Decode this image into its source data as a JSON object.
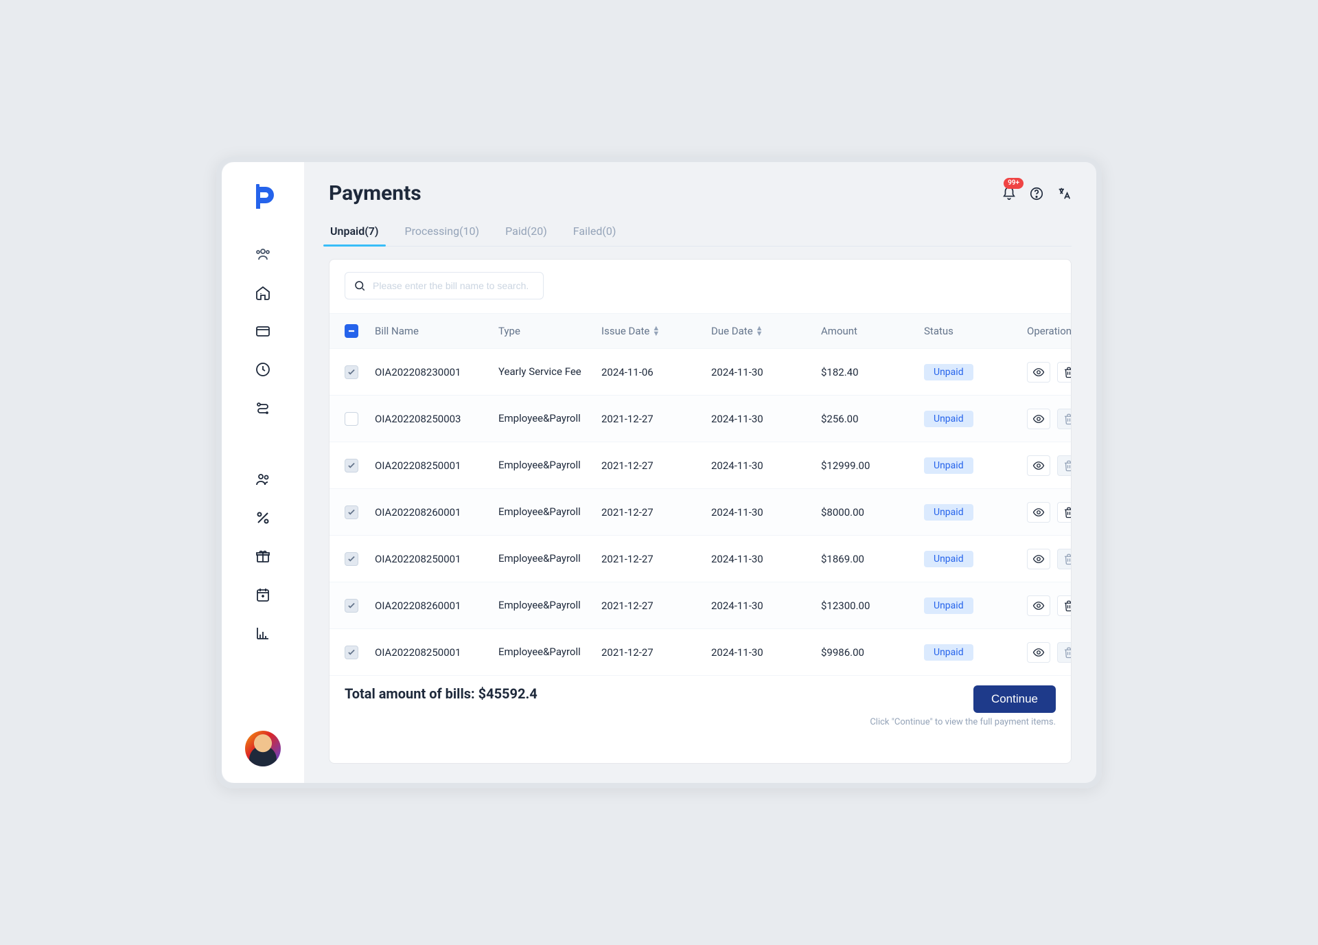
{
  "header": {
    "title": "Payments",
    "notification_badge": "99+"
  },
  "tabs": [
    {
      "label": "Unpaid(7)",
      "active": true
    },
    {
      "label": "Processing(10)",
      "active": false
    },
    {
      "label": "Paid(20)",
      "active": false
    },
    {
      "label": "Failed(0)",
      "active": false
    }
  ],
  "search": {
    "placeholder": "Please enter the bill name to search."
  },
  "columns": {
    "bill_name": "Bill Name",
    "type": "Type",
    "issue_date": "Issue Date",
    "due_date": "Due Date",
    "amount": "Amount",
    "status": "Status",
    "operation": "Operation"
  },
  "rows": [
    {
      "checked": true,
      "bill": "OIA202208230001",
      "type": "Yearly Service Fee",
      "issue": "2024-11-06",
      "due": "2024-11-30",
      "amount": "$182.40",
      "status": "Unpaid",
      "delete_disabled": false
    },
    {
      "checked": false,
      "bill": "OIA202208250003",
      "type": "Employee&Payroll",
      "issue": "2021-12-27",
      "due": "2024-11-30",
      "amount": "$256.00",
      "status": "Unpaid",
      "delete_disabled": true
    },
    {
      "checked": true,
      "bill": "OIA202208250001",
      "type": "Employee&Payroll",
      "issue": "2021-12-27",
      "due": "2024-11-30",
      "amount": "$12999.00",
      "status": "Unpaid",
      "delete_disabled": true
    },
    {
      "checked": true,
      "bill": "OIA202208260001",
      "type": "Employee&Payroll",
      "issue": "2021-12-27",
      "due": "2024-11-30",
      "amount": "$8000.00",
      "status": "Unpaid",
      "delete_disabled": false
    },
    {
      "checked": true,
      "bill": "OIA202208250001",
      "type": "Employee&Payroll",
      "issue": "2021-12-27",
      "due": "2024-11-30",
      "amount": "$1869.00",
      "status": "Unpaid",
      "delete_disabled": true
    },
    {
      "checked": true,
      "bill": "OIA202208260001",
      "type": "Employee&Payroll",
      "issue": "2021-12-27",
      "due": "2024-11-30",
      "amount": "$12300.00",
      "status": "Unpaid",
      "delete_disabled": false
    },
    {
      "checked": true,
      "bill": "OIA202208250001",
      "type": "Employee&Payroll",
      "issue": "2021-12-27",
      "due": "2024-11-30",
      "amount": "$9986.00",
      "status": "Unpaid",
      "delete_disabled": true
    }
  ],
  "footer": {
    "total_label": "Total amount of bills: $45592.4",
    "continue": "Continue",
    "hint": "Click \"Continue\" to view the full payment items."
  }
}
